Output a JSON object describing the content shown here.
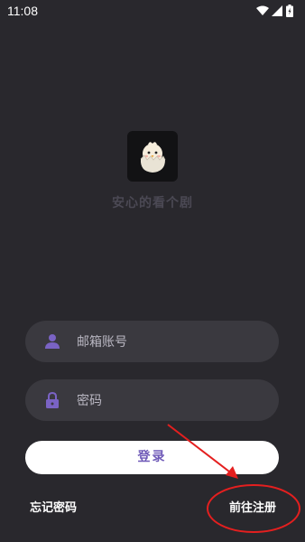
{
  "status_bar": {
    "time": "11:08",
    "icons": [
      "wifi-icon",
      "signal-icon",
      "battery-icon"
    ]
  },
  "app": {
    "name": "安心的看个剧",
    "logo_icon": "chick-in-eggshell-logo"
  },
  "form": {
    "email_placeholder": "邮箱账号",
    "email_icon": "user-icon",
    "password_placeholder": "密码",
    "password_icon": "lock-icon",
    "login_label": "登录",
    "forgot_label": "忘记密码",
    "register_label": "前往注册"
  },
  "colors": {
    "background": "#29282d",
    "field_background": "#3a393f",
    "accent": "#6f5ab8",
    "annotation": "#e41f1f"
  }
}
